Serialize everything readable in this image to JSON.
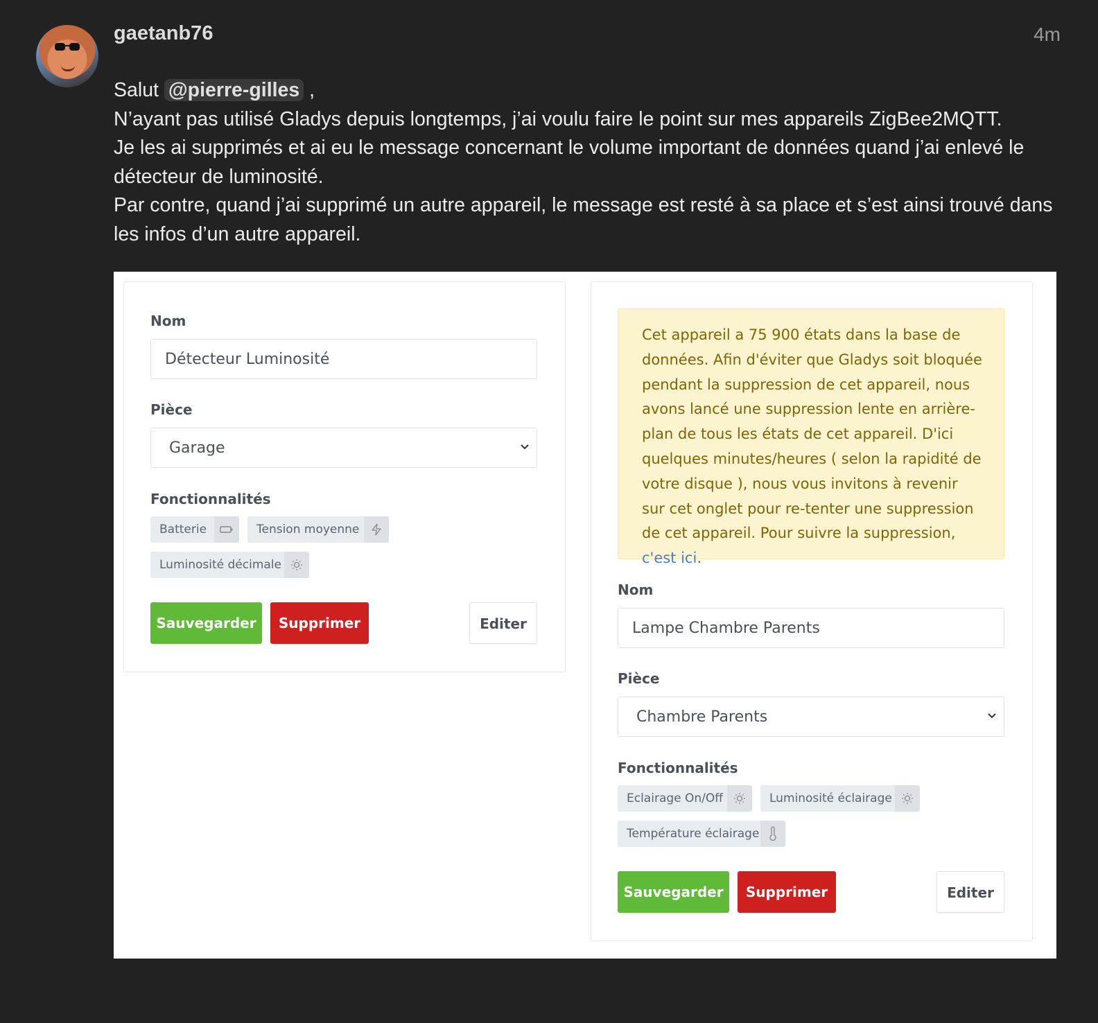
{
  "post": {
    "username": "gaetanb76",
    "time": "4m",
    "greeting": "Salut",
    "mention": "@pierre-gilles",
    "greeting_end": ",",
    "line1": "N’ayant pas utilisé Gladys depuis longtemps, j’ai voulu faire le point sur mes appareils ZigBee2MQTT.",
    "line2": "Je les ai supprimés et ai eu le message concernant le volume important de données quand j’ai enlevé le détecteur de luminosité.",
    "line3": "Par contre, quand j’ai supprimé un autre appareil, le message est resté à sa place et s’est ainsi trouvé dans les infos d’un autre appareil."
  },
  "left_card": {
    "name_label": "Nom",
    "name_value": "Détecteur Luminosité",
    "room_label": "Pièce",
    "room_value": "Garage",
    "features_label": "Fonctionnalités",
    "features": [
      {
        "label": "Batterie",
        "icon": "battery-icon"
      },
      {
        "label": "Tension moyenne",
        "icon": "zap-icon"
      },
      {
        "label": "Luminosité décimale",
        "icon": "sun-icon"
      }
    ],
    "save_label": "Sauvegarder",
    "delete_label": "Supprimer",
    "edit_label": "Editer"
  },
  "right_card": {
    "alert_text": "Cet appareil a 75 900 états dans la base de données. Afin d'éviter que Gladys soit bloquée pendant la suppression de cet appareil, nous avons lancé une suppression lente en arrière-plan de tous les états de cet appareil. D'ici quelques minutes/heures ( selon la rapidité de votre disque ), nous vous invitons à revenir sur cet onglet pour re-tenter une suppression de cet appareil. Pour suivre la suppression,",
    "alert_link": "c'est ici",
    "alert_end": ".",
    "name_label": "Nom",
    "name_value": "Lampe Chambre Parents",
    "room_label": "Pièce",
    "room_value": "Chambre Parents",
    "features_label": "Fonctionnalités",
    "features": [
      {
        "label": "Eclairage On/Off",
        "icon": "sun-icon"
      },
      {
        "label": "Luminosité éclairage",
        "icon": "sun-icon"
      },
      {
        "label": "Température éclairage",
        "icon": "thermometer-icon"
      }
    ],
    "save_label": "Sauvegarder",
    "delete_label": "Supprimer",
    "edit_label": "Editer"
  },
  "colors": {
    "page_bg": "#222222",
    "save": "#5eba37",
    "delete": "#cd201f",
    "alert_bg": "#fcf3cf",
    "alert_text": "#7d6608",
    "link": "#467fcf"
  }
}
